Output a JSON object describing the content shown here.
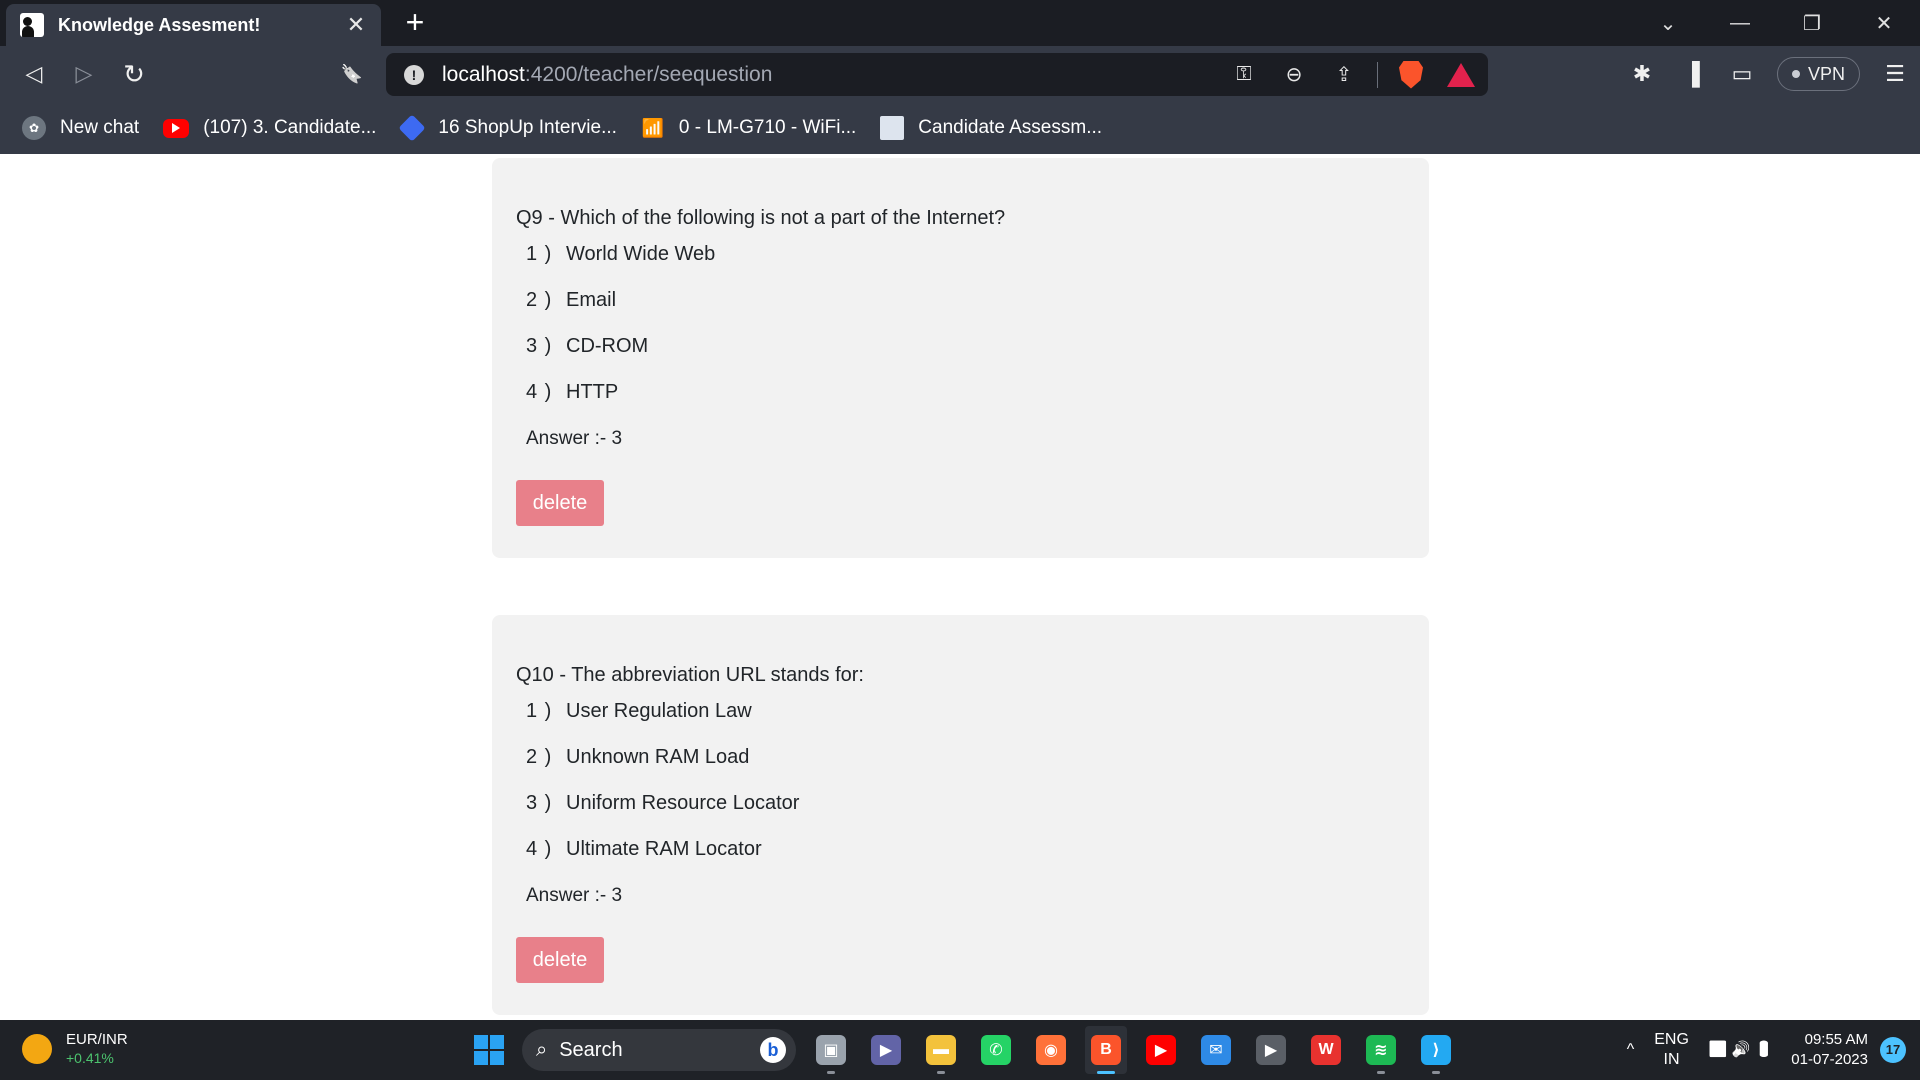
{
  "tab": {
    "title": "Knowledge Assesment!",
    "close_glyph": "✕",
    "new_tab_glyph": "+"
  },
  "window_controls": {
    "minimize": "—",
    "maximize": "❐",
    "close": "✕",
    "tab_search": "⌄"
  },
  "toolbar": {
    "back_glyph": "◁",
    "forward_glyph": "▷",
    "reload_glyph": "↻",
    "bookmark_glyph": "🔖",
    "url_host": "localhost",
    "url_path": ":4200/teacher/seequestion",
    "vpn_label": "VPN",
    "menu_glyph": "☰"
  },
  "bookmarks": [
    {
      "label": "New chat",
      "icon": "chatgpt-icon"
    },
    {
      "label": "(107) 3. Candidate...",
      "icon": "youtube-icon"
    },
    {
      "label": "16 ShopUp Intervie...",
      "icon": "shopup-icon"
    },
    {
      "label": "0 - LM-G710 - WiFi...",
      "icon": "wifi-icon"
    },
    {
      "label": "Candidate Assessm...",
      "icon": "document-icon"
    }
  ],
  "questions": [
    {
      "text": "Q9 - Which of the following is not a part of the Internet?",
      "options": [
        {
          "num": "1 )",
          "text": "World Wide Web"
        },
        {
          "num": "2 )",
          "text": "Email"
        },
        {
          "num": "3 )",
          "text": "CD-ROM"
        },
        {
          "num": "4 )",
          "text": "HTTP"
        }
      ],
      "answer": "Answer :- 3",
      "delete_label": "delete"
    },
    {
      "text": "Q10 - The abbreviation URL stands for:",
      "options": [
        {
          "num": "1 )",
          "text": "User Regulation Law"
        },
        {
          "num": "2 )",
          "text": "Unknown RAM Load"
        },
        {
          "num": "3 )",
          "text": "Uniform Resource Locator"
        },
        {
          "num": "4 )",
          "text": "Ultimate RAM Locator"
        }
      ],
      "answer": "Answer :- 3",
      "delete_label": "delete"
    }
  ],
  "taskbar": {
    "widget_title": "EUR/INR",
    "widget_change": "+0.41%",
    "search_label": "Search",
    "bing_glyph": "b",
    "apps": [
      {
        "name": "task-view",
        "glyph": "▣",
        "color": "#9aa3ad"
      },
      {
        "name": "teams",
        "glyph": "▶",
        "color": "#6264a7"
      },
      {
        "name": "file-explorer",
        "glyph": "▬",
        "color": "#f3c23c"
      },
      {
        "name": "whatsapp",
        "glyph": "✆",
        "color": "#25d366"
      },
      {
        "name": "firefox",
        "glyph": "◉",
        "color": "#ff7139"
      },
      {
        "name": "brave",
        "glyph": "B",
        "color": "#fb542b"
      },
      {
        "name": "youtube",
        "glyph": "▶",
        "color": "#ff0000"
      },
      {
        "name": "mail",
        "glyph": "✉",
        "color": "#2e8ae6"
      },
      {
        "name": "media-player",
        "glyph": "▶",
        "color": "#5a5f66"
      },
      {
        "name": "wps-office",
        "glyph": "W",
        "color": "#e8322f"
      },
      {
        "name": "spotify",
        "glyph": "≋",
        "color": "#1db954"
      },
      {
        "name": "vscode",
        "glyph": "⟩",
        "color": "#23a9f2"
      }
    ],
    "tray_chevron": "^",
    "lang_top": "ENG",
    "lang_bottom": "IN",
    "tray_icons": "📶 🔊 🔋",
    "time": "09:55 AM",
    "date": "01-07-2023",
    "notification_count": "17"
  }
}
